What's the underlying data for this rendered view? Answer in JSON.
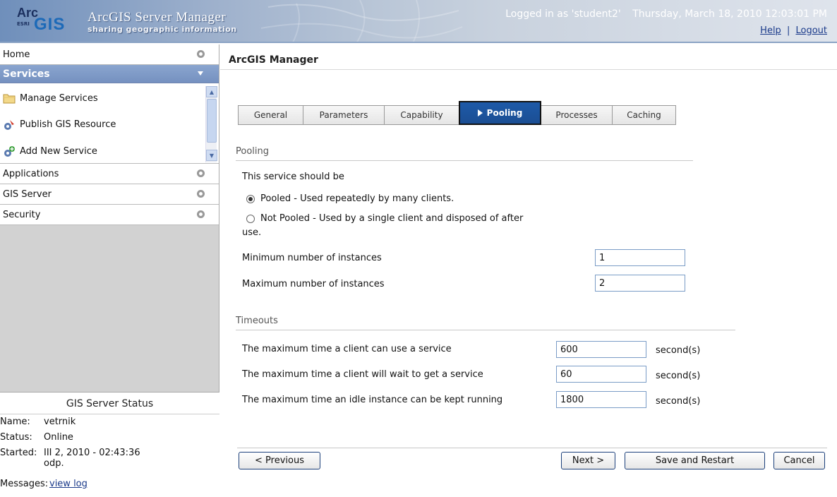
{
  "header": {
    "logo_arc": "Arc",
    "logo_gis": "GIS",
    "logo_esri": "ESRI",
    "app_title": "ArcGIS Server Manager",
    "app_subtitle": "sharing geographic information",
    "logged_in": "Logged in as 'student2'",
    "datetime": "Thursday, March 18, 2010 12:03:01 PM",
    "help_link": "Help",
    "separator": "|",
    "logout_link": "Logout"
  },
  "sidebar": {
    "home": "Home",
    "services": "Services",
    "services_items": [
      "Manage Services",
      "Publish GIS Resource",
      "Add New Service"
    ],
    "applications": "Applications",
    "gis_server": "GIS Server",
    "security": "Security",
    "status": {
      "title": "GIS Server Status",
      "name_label": "Name:",
      "name_value": "vetrnik",
      "status_label": "Status:",
      "status_value": "Online",
      "started_label": "Started:",
      "started_value_line1": "III 2, 2010 - 02:43:36",
      "started_value_line2": "odp.",
      "messages_label": "Messages:",
      "messages_link": "view log"
    }
  },
  "main": {
    "title": "ArcGIS Manager",
    "tabs": [
      {
        "label": "General",
        "active": false
      },
      {
        "label": "Parameters",
        "active": false
      },
      {
        "label": "Capability",
        "active": false
      },
      {
        "label": "Pooling",
        "active": true
      },
      {
        "label": "Processes",
        "active": false
      },
      {
        "label": "Caching",
        "active": false
      }
    ],
    "pooling": {
      "section": "Pooling",
      "intro": "This service should be",
      "option_pooled": "Pooled - Used repeatedly by many clients.",
      "option_not_pooled_line1": "Not Pooled - Used by a single client and disposed of after",
      "option_not_pooled_line2": "use.",
      "selected": "pooled",
      "min_label": "Minimum number of instances",
      "min_value": "1",
      "max_label": "Maximum number of instances",
      "max_value": "2"
    },
    "timeouts": {
      "section": "Timeouts",
      "use_label": "The maximum time a client can use a service",
      "use_value": "600",
      "wait_label": "The maximum time a client will wait to get a service",
      "wait_value": "60",
      "idle_label": "The maximum time an idle instance can be kept running",
      "idle_value": "1800",
      "unit": "second(s)"
    },
    "buttons": {
      "previous": "< Previous",
      "next": "Next >",
      "save_restart": "Save and Restart",
      "cancel": "Cancel"
    }
  },
  "colors": {
    "services_header": "#7f9bc8",
    "active_tab": "#1e5aa8",
    "sidebar_bg": "#d2d2d2",
    "link": "#1a3a8a"
  }
}
